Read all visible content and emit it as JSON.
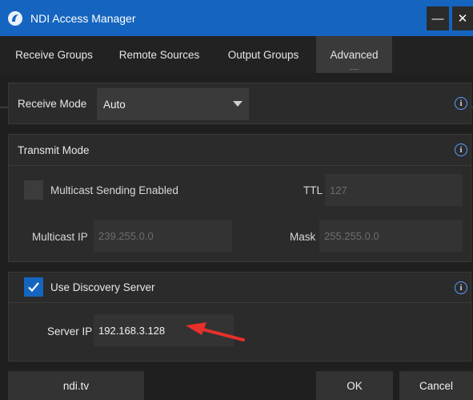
{
  "window": {
    "title": "NDI Access Manager",
    "minimize_label": "—",
    "close_label": "✕",
    "accent_color": "#1565c0"
  },
  "tabs": [
    {
      "label": "Receive Groups",
      "active": false
    },
    {
      "label": "Remote Sources",
      "active": false
    },
    {
      "label": "Output Groups",
      "active": false
    },
    {
      "label": "Advanced",
      "active": true
    }
  ],
  "receive": {
    "label": "Receive Mode",
    "value": "Auto",
    "info": "i"
  },
  "transmit": {
    "label": "Transmit Mode",
    "info": "i",
    "multicast_label": "Multicast Sending Enabled",
    "multicast_checked": false,
    "ttl_label": "TTL",
    "ttl_value": "127",
    "multicast_ip_label": "Multicast IP",
    "multicast_ip_value": "239.255.0.0",
    "mask_label": "Mask",
    "mask_value": "255.255.0.0"
  },
  "discovery": {
    "label": "Use Discovery Server",
    "checked": true,
    "info": "i",
    "server_ip_label": "Server IP",
    "server_ip_value": "192.168.3.128"
  },
  "footer": {
    "ndi_label": "ndi.tv",
    "ok_label": "OK",
    "cancel_label": "Cancel"
  }
}
